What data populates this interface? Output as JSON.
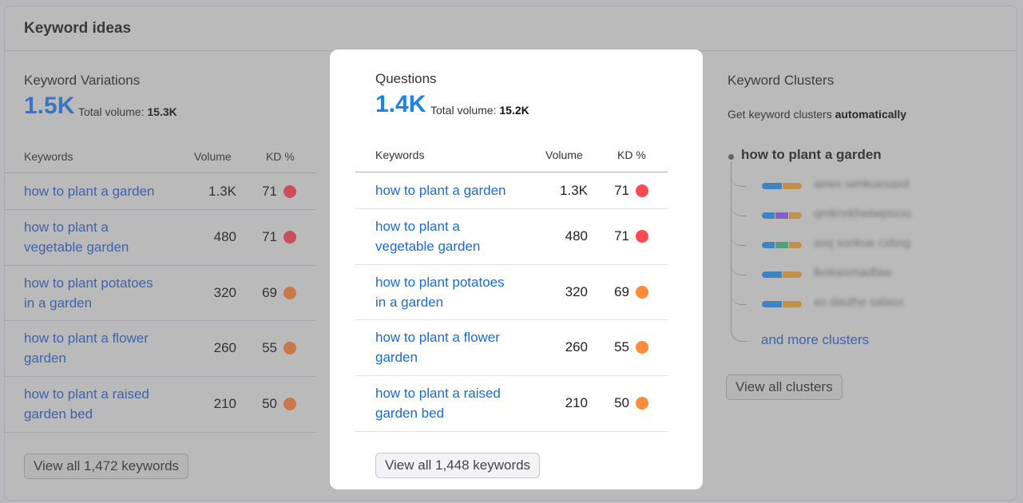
{
  "card": {
    "title": "Keyword ideas"
  },
  "variations": {
    "title": "Keyword Variations",
    "count": "1.5K",
    "total_label": "Total volume:",
    "total_value": "15.3K",
    "headers": {
      "keywords": "Keywords",
      "volume": "Volume",
      "kd": "KD %"
    },
    "rows": [
      {
        "keyword": [
          "how to plant a garden"
        ],
        "volume": "1.3K",
        "kd": "71",
        "kd_color": "#c9505a"
      },
      {
        "keyword": [
          "how to plant a",
          "vegetable garden"
        ],
        "volume": "480",
        "kd": "71",
        "kd_color": "#c9505a"
      },
      {
        "keyword": [
          "how to plant potatoes",
          "in a garden"
        ],
        "volume": "320",
        "kd": "69",
        "kd_color": "#c7794a"
      },
      {
        "keyword": [
          "how to plant a flower",
          "garden"
        ],
        "volume": "260",
        "kd": "55",
        "kd_color": "#c7794a"
      },
      {
        "keyword": [
          "how to plant a raised",
          "garden bed"
        ],
        "volume": "210",
        "kd": "50",
        "kd_color": "#c7794a"
      }
    ],
    "button": "View all 1,472 keywords",
    "accent": "#3b74c4"
  },
  "questions": {
    "title": "Questions",
    "count": "1.4K",
    "total_label": "Total volume:",
    "total_value": "15.2K",
    "headers": {
      "keywords": "Keywords",
      "volume": "Volume",
      "kd": "KD %"
    },
    "rows": [
      {
        "keyword": [
          "how to plant a garden"
        ],
        "volume": "1.3K",
        "kd": "71",
        "kd_color": "#ff4953"
      },
      {
        "keyword": [
          "how to plant a",
          "vegetable garden"
        ],
        "volume": "480",
        "kd": "71",
        "kd_color": "#ff4953"
      },
      {
        "keyword": [
          "how to plant potatoes",
          "in a garden"
        ],
        "volume": "320",
        "kd": "69",
        "kd_color": "#ff8c3b"
      },
      {
        "keyword": [
          "how to plant a flower",
          "garden"
        ],
        "volume": "260",
        "kd": "55",
        "kd_color": "#ff8c3b"
      },
      {
        "keyword": [
          "how to plant a raised",
          "garden bed"
        ],
        "volume": "210",
        "kd": "50",
        "kd_color": "#ff8c3b"
      }
    ],
    "button": "View all 1,448 keywords",
    "accent": "#1a85e8"
  },
  "clusters": {
    "title": "Keyword Clusters",
    "subtitle_prefix": "Get keyword clusters",
    "subtitle_bold": "automatically",
    "root": "how to plant a garden",
    "items": [
      {
        "label": "aewx senkuesaxd",
        "bar": [
          "#3f84c0",
          "#c0914a"
        ]
      },
      {
        "label": "qmknxkhwiwpsxxc",
        "bar": [
          "#3f84c0",
          "#8660c0",
          "#c0914a"
        ]
      },
      {
        "label": "asq xonkue cxbng",
        "bar": [
          "#3f84c0",
          "#4ea07e",
          "#c0914a"
        ]
      },
      {
        "label": "lknkwxmadfaw",
        "bar": [
          "#3f84c0",
          "#c0914a"
        ]
      },
      {
        "label": "as dauthe salasx",
        "bar": [
          "#3f84c0",
          "#c0914a"
        ]
      }
    ],
    "more_link": "and more clusters",
    "button": "View all clusters"
  }
}
